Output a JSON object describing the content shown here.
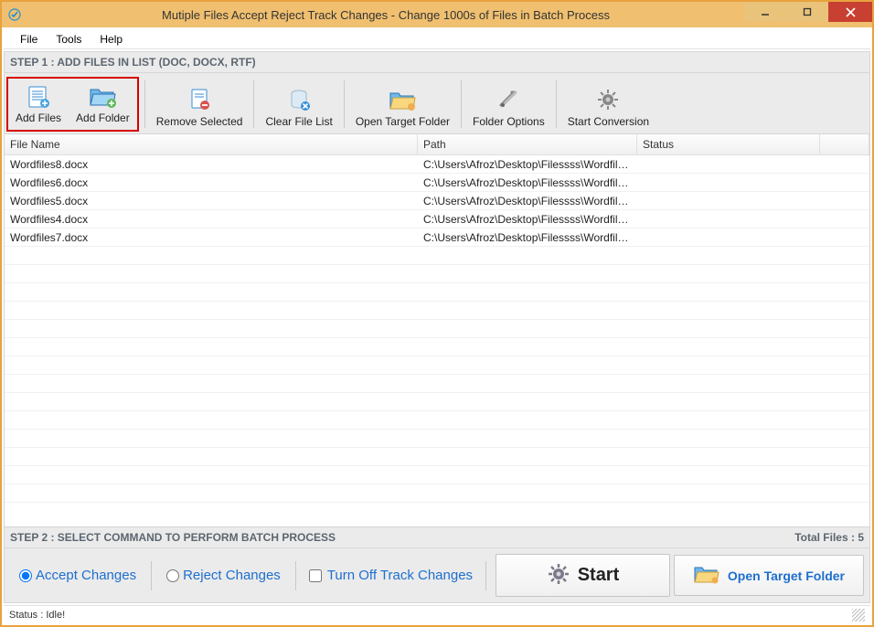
{
  "window": {
    "title": "Mutiple Files Accept Reject Track Changes - Change 1000s of Files in Batch Process"
  },
  "menubar": {
    "file": "File",
    "tools": "Tools",
    "help": "Help"
  },
  "step1_label": "STEP 1 : ADD FILES IN LIST (DOC, DOCX, RTF)",
  "toolbar": {
    "add_files": "Add Files",
    "add_folder": "Add Folder",
    "remove_selected": "Remove Selected",
    "clear_file_list": "Clear File List",
    "open_target_folder": "Open Target Folder",
    "folder_options": "Folder Options",
    "start_conversion": "Start Conversion"
  },
  "grid": {
    "headers": {
      "name": "File Name",
      "path": "Path",
      "status": "Status"
    },
    "rows": [
      {
        "name": "Wordfiles8.docx",
        "path": "C:\\Users\\Afroz\\Desktop\\Filessss\\Wordfiles...",
        "status": ""
      },
      {
        "name": "Wordfiles6.docx",
        "path": "C:\\Users\\Afroz\\Desktop\\Filessss\\Wordfiles...",
        "status": ""
      },
      {
        "name": "Wordfiles5.docx",
        "path": "C:\\Users\\Afroz\\Desktop\\Filessss\\Wordfiles...",
        "status": ""
      },
      {
        "name": "Wordfiles4.docx",
        "path": "C:\\Users\\Afroz\\Desktop\\Filessss\\Wordfiles...",
        "status": ""
      },
      {
        "name": "Wordfiles7.docx",
        "path": "C:\\Users\\Afroz\\Desktop\\Filessss\\Wordfiles...",
        "status": ""
      }
    ]
  },
  "step2_label": "STEP 2 : SELECT COMMAND TO PERFORM BATCH PROCESS",
  "total_files_label": "Total Files : 5",
  "options": {
    "accept_changes": "Accept Changes",
    "reject_changes": "Reject Changes",
    "turn_off_track": "Turn Off Track Changes",
    "start": "Start",
    "open_target_folder": "Open Target Folder"
  },
  "statusbar": {
    "text": "Status :   Idle!"
  }
}
